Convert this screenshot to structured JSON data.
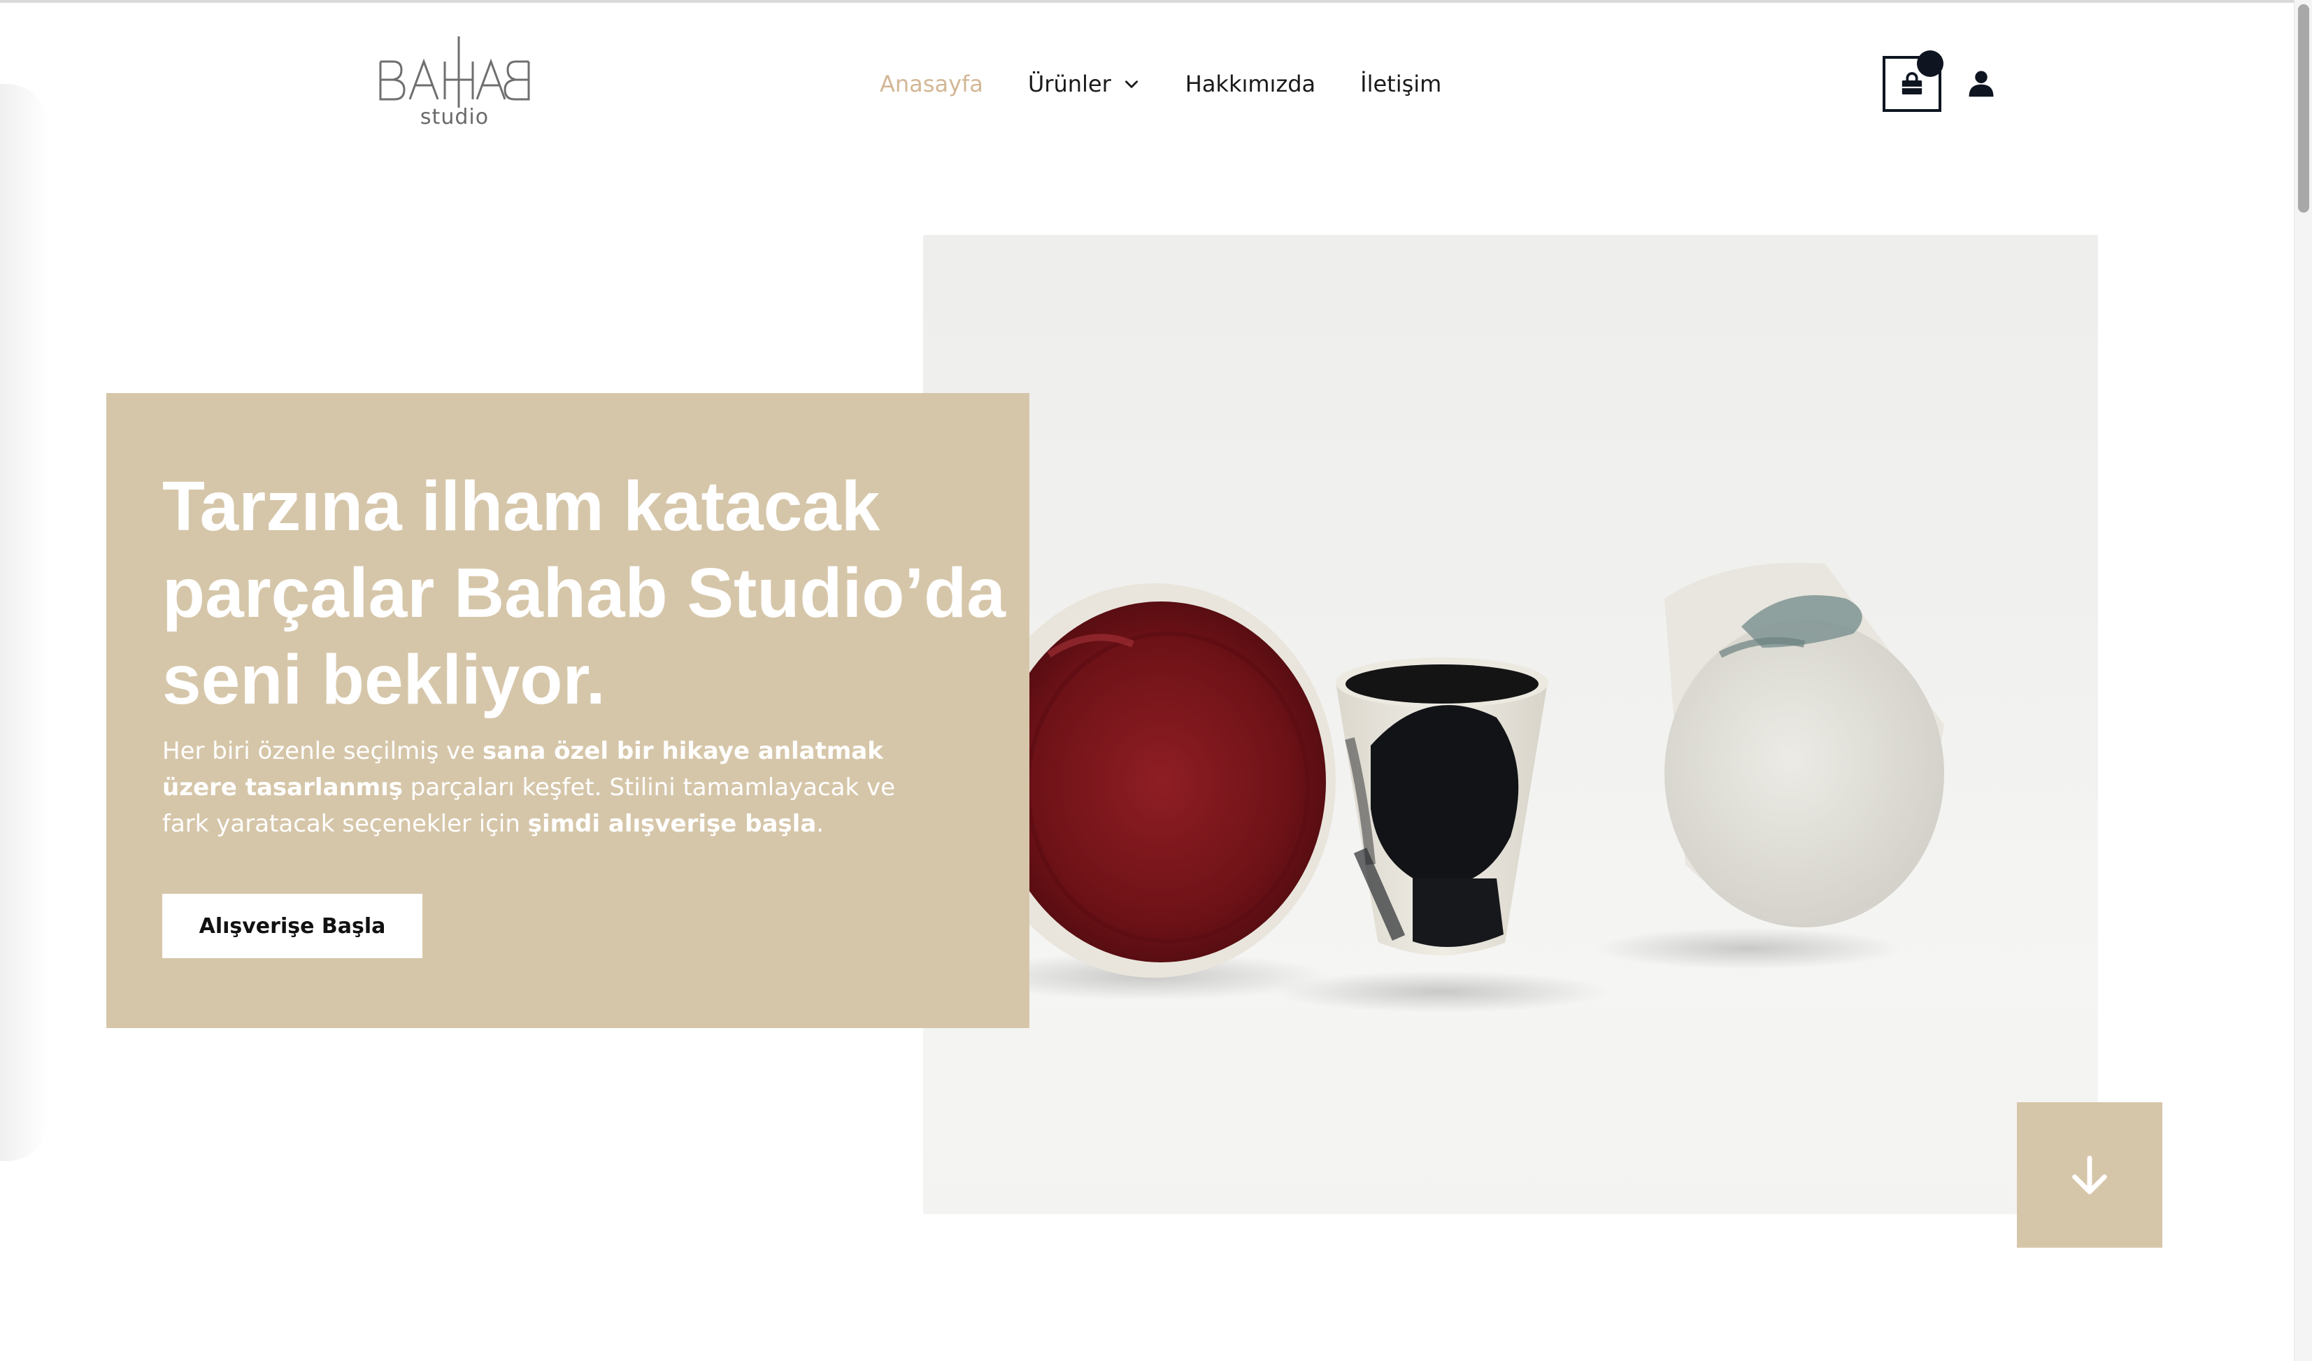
{
  "brand": {
    "logo_wordmark": "BAHAB",
    "logo_sub": "studio"
  },
  "nav": {
    "items": [
      {
        "label": "Anasayfa",
        "active": true
      },
      {
        "label": "Ürünler",
        "has_dropdown": true
      },
      {
        "label": "Hakkımızda"
      },
      {
        "label": "İletişim"
      }
    ]
  },
  "header_icons": {
    "cart": "shopping-bag-icon",
    "account": "user-icon"
  },
  "hero": {
    "title_lines": [
      "Tarzına ilham katacak",
      "parçalar Bahab Studio’da",
      "seni bekliyor."
    ],
    "text": {
      "p1": "Her biri özenle seçilmiş ve ",
      "b1": "sana özel bir hikaye anlatmak üzere tasarlanmış",
      "p2": " parçaları keşfet. Stilini tamamlayacak ve fark yaratacak seçenekler için ",
      "b2": "şimdi alışverişe başla",
      "p3": "."
    },
    "cta_label": "Alışverişe Başla",
    "scroll_icon": "arrow-down-icon"
  },
  "colors": {
    "accent": "#d6c6a9",
    "nav_active": "#d3b796",
    "dark": "#0e1520"
  }
}
